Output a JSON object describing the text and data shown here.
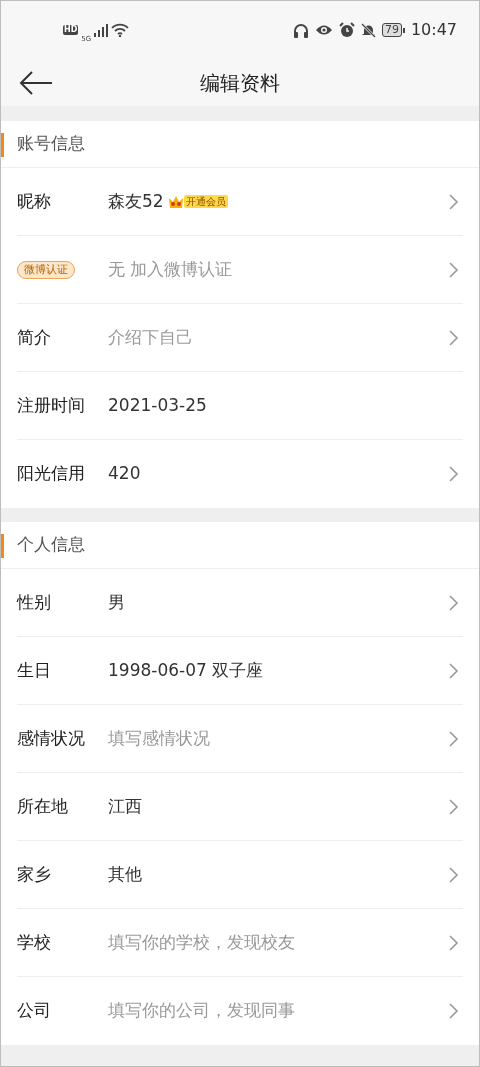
{
  "status_bar": {
    "hd": "HD",
    "network": "5G",
    "battery": "79",
    "time": "10:47"
  },
  "header": {
    "title": "编辑资料"
  },
  "sections": [
    {
      "title": "账号信息",
      "rows": [
        {
          "label": "昵称",
          "kind": "text",
          "value": "森友52",
          "badge": "开通会员",
          "chevron": true
        },
        {
          "label": "微博认证",
          "kind": "badge",
          "placeholder": "无 加入微博认证",
          "chevron": true
        },
        {
          "label": "简介",
          "kind": "text",
          "placeholder": "介绍下自己",
          "chevron": true
        },
        {
          "label": "注册时间",
          "kind": "text",
          "value": "2021-03-25",
          "chevron": false
        },
        {
          "label": "阳光信用",
          "kind": "text",
          "value": "420",
          "chevron": true
        }
      ]
    },
    {
      "title": "个人信息",
      "rows": [
        {
          "label": "性别",
          "kind": "text",
          "value": "男",
          "chevron": true
        },
        {
          "label": "生日",
          "kind": "text",
          "value": "1998-06-07 双子座",
          "chevron": true
        },
        {
          "label": "感情状况",
          "kind": "text",
          "placeholder": "填写感情状况",
          "chevron": true
        },
        {
          "label": "所在地",
          "kind": "text",
          "value": "江西",
          "chevron": true
        },
        {
          "label": "家乡",
          "kind": "text",
          "value": "其他",
          "chevron": true
        },
        {
          "label": "学校",
          "kind": "text",
          "placeholder": "填写你的学校，发现校友",
          "chevron": true
        },
        {
          "label": "公司",
          "kind": "text",
          "placeholder": "填写你的公司，发现同事",
          "chevron": true
        }
      ]
    }
  ]
}
